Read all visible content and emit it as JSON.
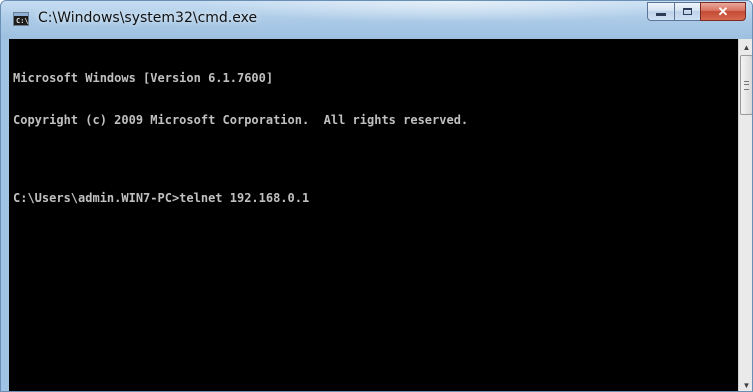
{
  "window": {
    "title": "C:\\Windows\\system32\\cmd.exe",
    "icon": "cmd-icon",
    "icon_text": "C:\\"
  },
  "caption_buttons": {
    "minimize_icon": "minimize-icon",
    "maximize_icon": "maximize-icon",
    "close_label": "✕"
  },
  "console": {
    "line1": "Microsoft Windows [Version 6.1.7600]",
    "line2": "Copyright (c) 2009 Microsoft Corporation.  All rights reserved.",
    "line3": "C:\\Users\\admin.WIN7-PC>telnet 192.168.0.1",
    "background_color": "#000000",
    "text_color": "#c0c0c0"
  },
  "scrollbar": {
    "up_arrow": "▲",
    "down_arrow": "▼"
  }
}
